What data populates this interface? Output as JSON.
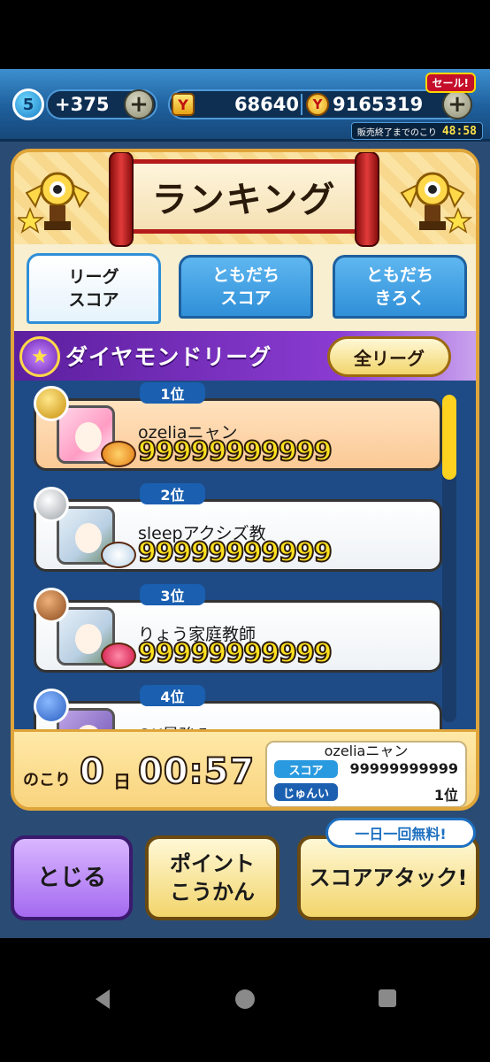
{
  "topbar": {
    "stamina_level": "5",
    "stamina_value": "+375",
    "coins": "68640",
    "gems": "9165319",
    "sale_label": "セール!",
    "sale_timer_label": "販売終了までのこり",
    "sale_timer": "48:58"
  },
  "panel": {
    "title": "ランキング",
    "tabs": [
      {
        "label": "リーグ\nスコア"
      },
      {
        "label": "ともだち\nスコア"
      },
      {
        "label": "ともだち\nきろく"
      }
    ],
    "league_name": "ダイヤモンドリーグ",
    "all_league_button": "全リーグ"
  },
  "rankings": [
    {
      "rank": "1位",
      "name": "ozeliaニャン",
      "score": "99999999999"
    },
    {
      "rank": "2位",
      "name": "sleepアクシズ教",
      "score": "99999999999"
    },
    {
      "rank": "3位",
      "name": "りょう家庭教師",
      "score": "99999999999"
    },
    {
      "rank": "4位",
      "name": "OK最強み",
      "score": ""
    }
  ],
  "footer": {
    "remain_label": "のこり",
    "remain_days": "0",
    "remain_day_unit": "日",
    "remain_time": "00:57",
    "my_name": "ozeliaニャン",
    "score_label": "スコア",
    "score_value": "99999999999",
    "rank_label": "じゅんい",
    "rank_value": "1位"
  },
  "buttons": {
    "close": "とじる",
    "points": "ポイント\nこうかん",
    "attack": "スコアアタック!",
    "free_tag": "一日一回無料!"
  },
  "colors": {
    "accent_blue": "#1a5fb0",
    "league_purple": "#8a3bd1",
    "score_yellow": "#ffe11f"
  }
}
